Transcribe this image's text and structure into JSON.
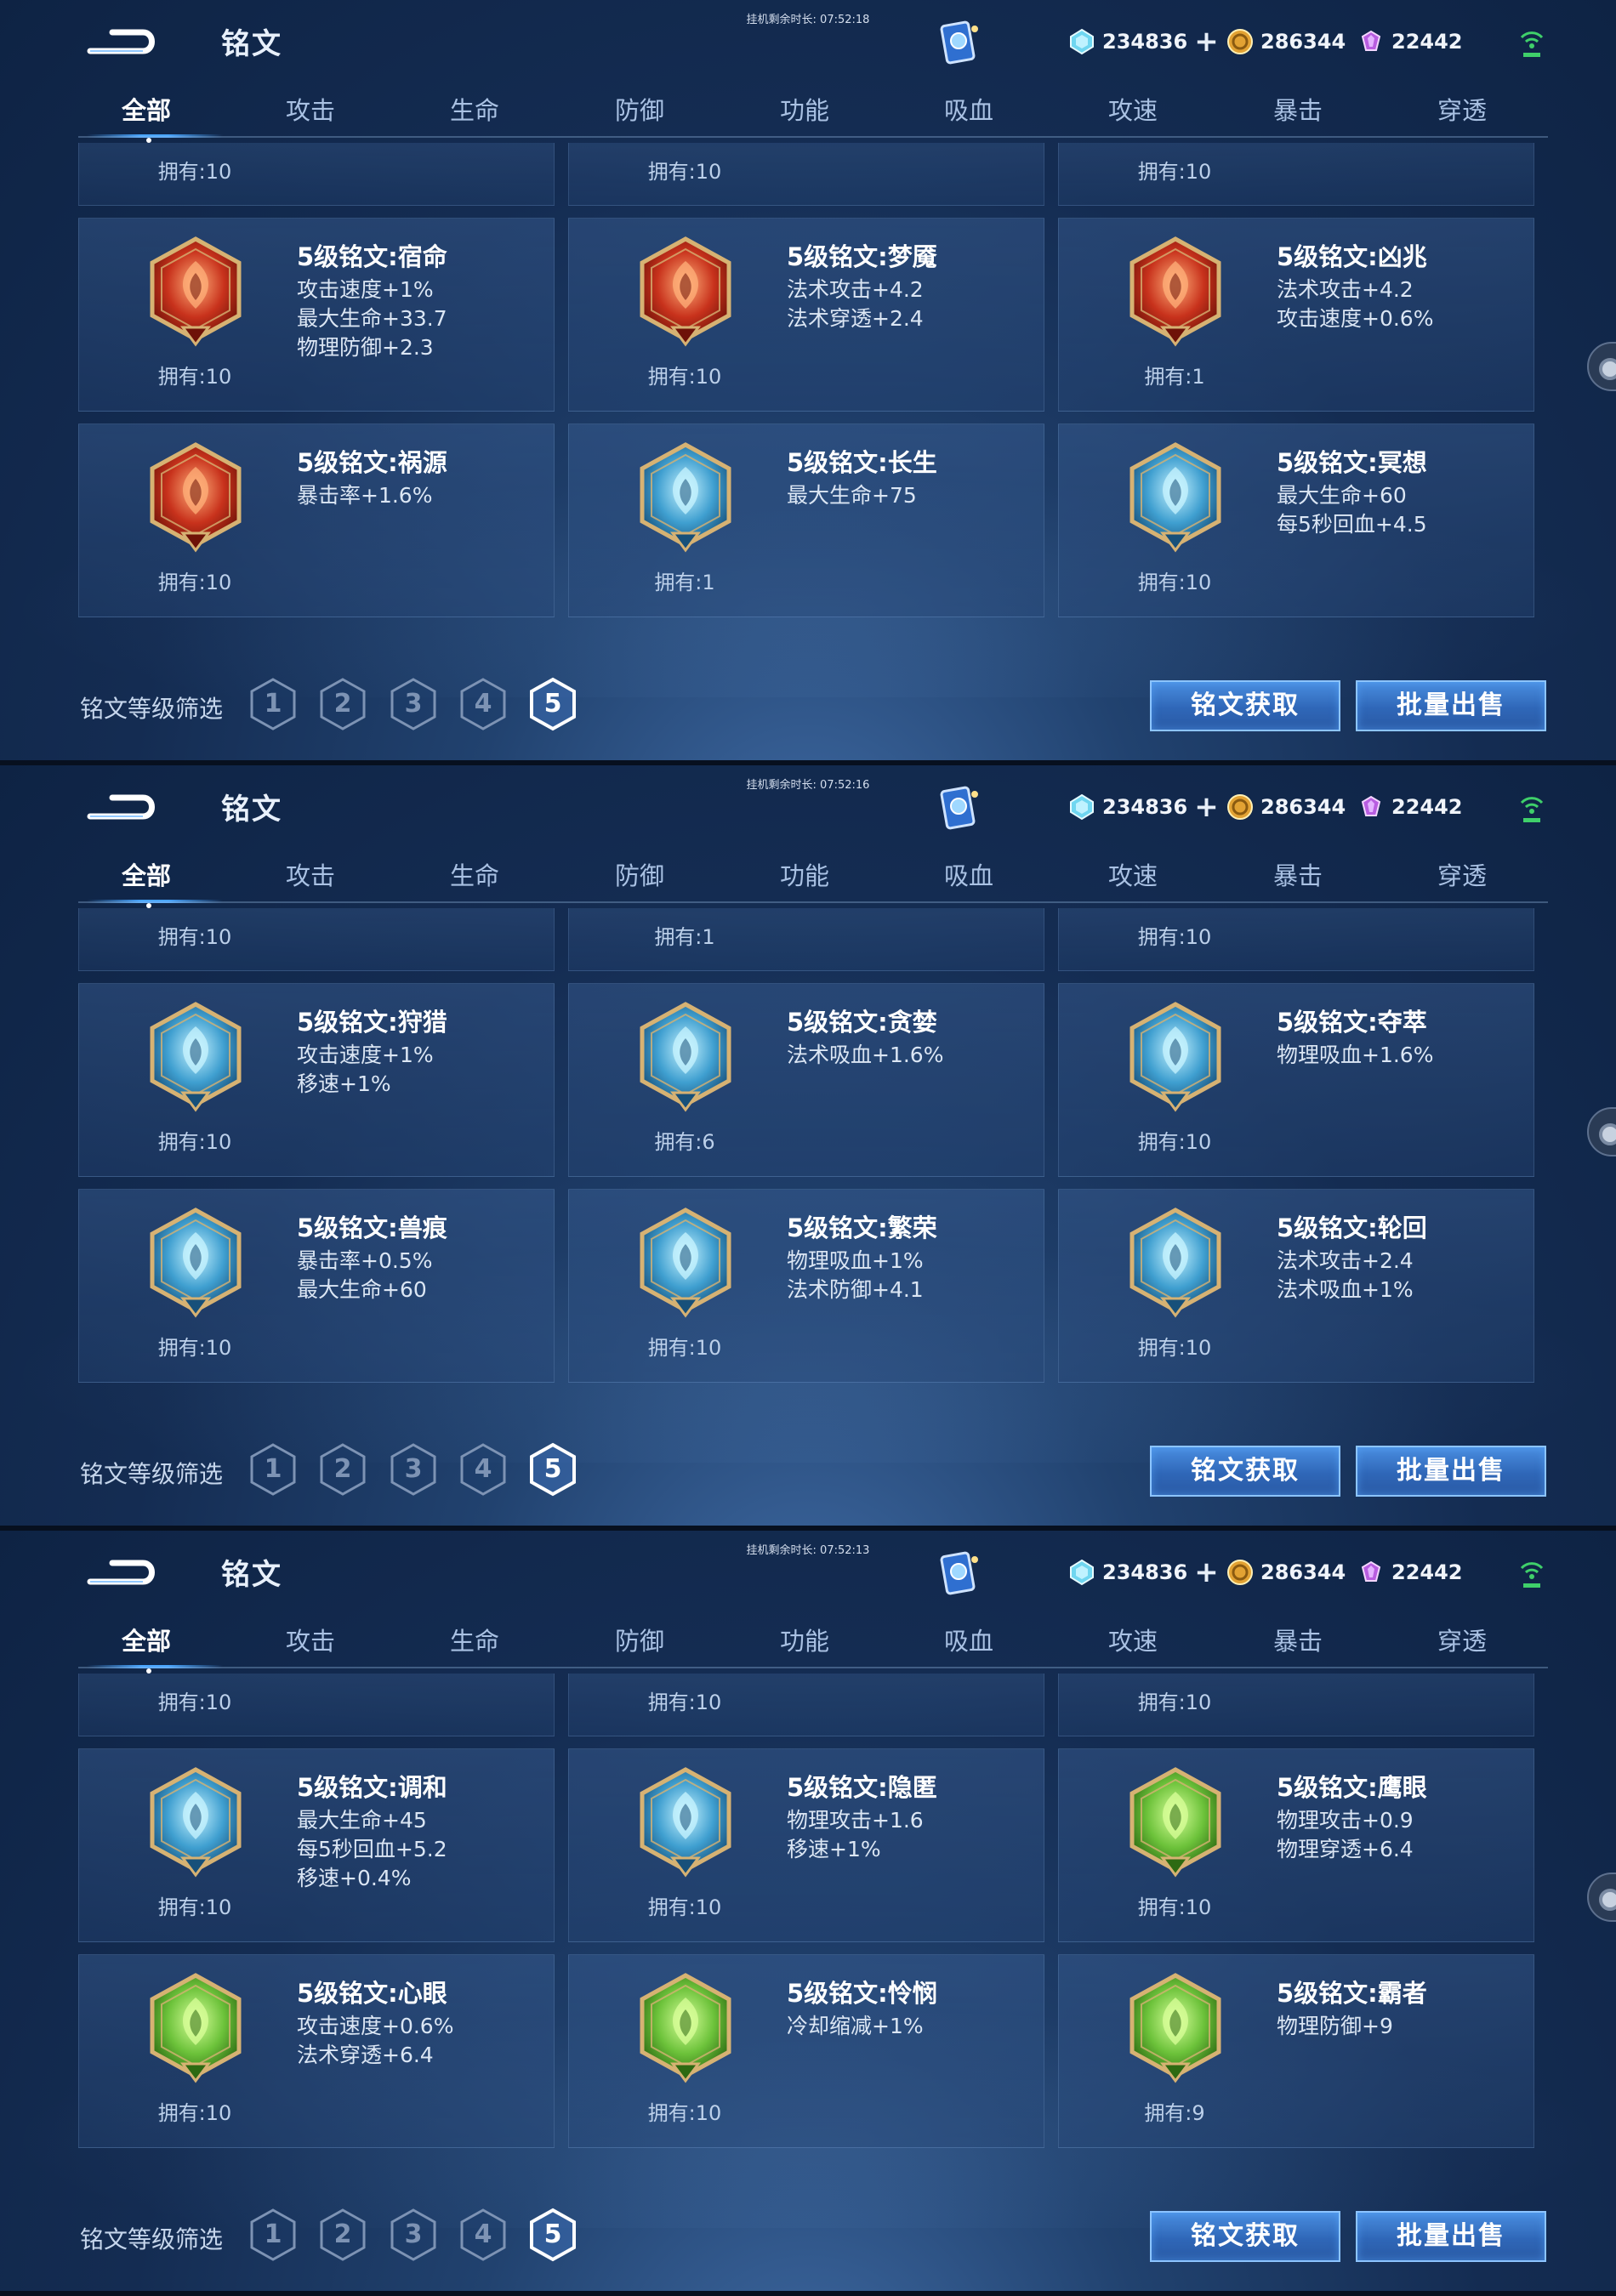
{
  "panels": [
    {
      "timer": "挂机剩余时长: 07:52:18",
      "title": "铭文",
      "resources": {
        "diamond": "234836",
        "gold": "286344",
        "gem": "22442"
      },
      "tabs": [
        "全部",
        "攻击",
        "生命",
        "防御",
        "功能",
        "吸血",
        "攻速",
        "暴击",
        "穿透"
      ],
      "partial_own": [
        "拥有:10",
        "拥有:10",
        "拥有:10"
      ],
      "cards": [
        {
          "name": "5级铭文:宿命",
          "stats": [
            "攻击速度+1%",
            "最大生命+33.7",
            "物理防御+2.3"
          ],
          "own": "拥有:10",
          "color": "red",
          "icon": "fate-rune-icon"
        },
        {
          "name": "5级铭文:梦魇",
          "stats": [
            "法术攻击+4.2",
            "法术穿透+2.4"
          ],
          "own": "拥有:10",
          "color": "red",
          "icon": "nightmare-rune-icon"
        },
        {
          "name": "5级铭文:凶兆",
          "stats": [
            "法术攻击+4.2",
            "攻击速度+0.6%"
          ],
          "own": "拥有:1",
          "color": "red",
          "icon": "omen-rune-icon"
        },
        {
          "name": "5级铭文:祸源",
          "stats": [
            "暴击率+1.6%"
          ],
          "own": "拥有:10",
          "color": "red",
          "icon": "calamity-rune-icon"
        },
        {
          "name": "5级铭文:长生",
          "stats": [
            "最大生命+75"
          ],
          "own": "拥有:1",
          "color": "blue",
          "icon": "longevity-rune-icon"
        },
        {
          "name": "5级铭文:冥想",
          "stats": [
            "最大生命+60",
            "每5秒回血+4.5"
          ],
          "own": "拥有:10",
          "color": "blue",
          "icon": "meditation-rune-icon"
        }
      ],
      "filter_label": "铭文等级筛选",
      "levels": [
        "1",
        "2",
        "3",
        "4",
        "5"
      ],
      "selected_level": "5",
      "buttons": {
        "acquire": "铭文获取",
        "sell": "批量出售"
      }
    },
    {
      "timer": "挂机剩余时长: 07:52:16",
      "title": "铭文",
      "resources": {
        "diamond": "234836",
        "gold": "286344",
        "gem": "22442"
      },
      "tabs": [
        "全部",
        "攻击",
        "生命",
        "防御",
        "功能",
        "吸血",
        "攻速",
        "暴击",
        "穿透"
      ],
      "partial_own": [
        "拥有:10",
        "拥有:1",
        "拥有:10"
      ],
      "cards": [
        {
          "name": "5级铭文:狩猎",
          "stats": [
            "攻击速度+1%",
            "移速+1%"
          ],
          "own": "拥有:10",
          "color": "blue",
          "icon": "hunt-rune-icon"
        },
        {
          "name": "5级铭文:贪婪",
          "stats": [
            "法术吸血+1.6%"
          ],
          "own": "拥有:6",
          "color": "blue",
          "icon": "greed-rune-icon"
        },
        {
          "name": "5级铭文:夺萃",
          "stats": [
            "物理吸血+1.6%"
          ],
          "own": "拥有:10",
          "color": "blue",
          "icon": "plunder-rune-icon"
        },
        {
          "name": "5级铭文:兽痕",
          "stats": [
            "暴击率+0.5%",
            "最大生命+60"
          ],
          "own": "拥有:10",
          "color": "blue",
          "icon": "beast-mark-rune-icon"
        },
        {
          "name": "5级铭文:繁荣",
          "stats": [
            "物理吸血+1%",
            "法术防御+4.1"
          ],
          "own": "拥有:10",
          "color": "blue",
          "icon": "prosperity-rune-icon"
        },
        {
          "name": "5级铭文:轮回",
          "stats": [
            "法术攻击+2.4",
            "法术吸血+1%"
          ],
          "own": "拥有:10",
          "color": "blue",
          "icon": "reincarnation-rune-icon"
        }
      ],
      "filter_label": "铭文等级筛选",
      "levels": [
        "1",
        "2",
        "3",
        "4",
        "5"
      ],
      "selected_level": "5",
      "buttons": {
        "acquire": "铭文获取",
        "sell": "批量出售"
      }
    },
    {
      "timer": "挂机剩余时长: 07:52:13",
      "title": "铭文",
      "resources": {
        "diamond": "234836",
        "gold": "286344",
        "gem": "22442"
      },
      "tabs": [
        "全部",
        "攻击",
        "生命",
        "防御",
        "功能",
        "吸血",
        "攻速",
        "暴击",
        "穿透"
      ],
      "partial_own": [
        "拥有:10",
        "拥有:10",
        "拥有:10"
      ],
      "cards": [
        {
          "name": "5级铭文:调和",
          "stats": [
            "最大生命+45",
            "每5秒回血+5.2",
            "移速+0.4%"
          ],
          "own": "拥有:10",
          "color": "blue",
          "icon": "harmony-rune-icon"
        },
        {
          "name": "5级铭文:隐匿",
          "stats": [
            "物理攻击+1.6",
            "移速+1%"
          ],
          "own": "拥有:10",
          "color": "blue",
          "icon": "stealth-rune-icon"
        },
        {
          "name": "5级铭文:鹰眼",
          "stats": [
            "物理攻击+0.9",
            "物理穿透+6.4"
          ],
          "own": "拥有:10",
          "color": "green",
          "icon": "eagle-eye-rune-icon"
        },
        {
          "name": "5级铭文:心眼",
          "stats": [
            "攻击速度+0.6%",
            "法术穿透+6.4"
          ],
          "own": "拥有:10",
          "color": "green",
          "icon": "mind-eye-rune-icon"
        },
        {
          "name": "5级铭文:怜悯",
          "stats": [
            "冷却缩减+1%"
          ],
          "own": "拥有:10",
          "color": "green",
          "icon": "mercy-rune-icon"
        },
        {
          "name": "5级铭文:霸者",
          "stats": [
            "物理防御+9"
          ],
          "own": "拥有:9",
          "color": "green",
          "icon": "overlord-rune-icon"
        }
      ],
      "filter_label": "铭文等级筛选",
      "levels": [
        "1",
        "2",
        "3",
        "4",
        "5"
      ],
      "selected_level": "5",
      "buttons": {
        "acquire": "铭文获取",
        "sell": "批量出售"
      }
    }
  ],
  "colors": {
    "red": "#c8321c",
    "blue": "#3f9fd0",
    "green": "#6cc23a",
    "accent": "#4aa6ff",
    "gold_frame": "#d6b273"
  }
}
